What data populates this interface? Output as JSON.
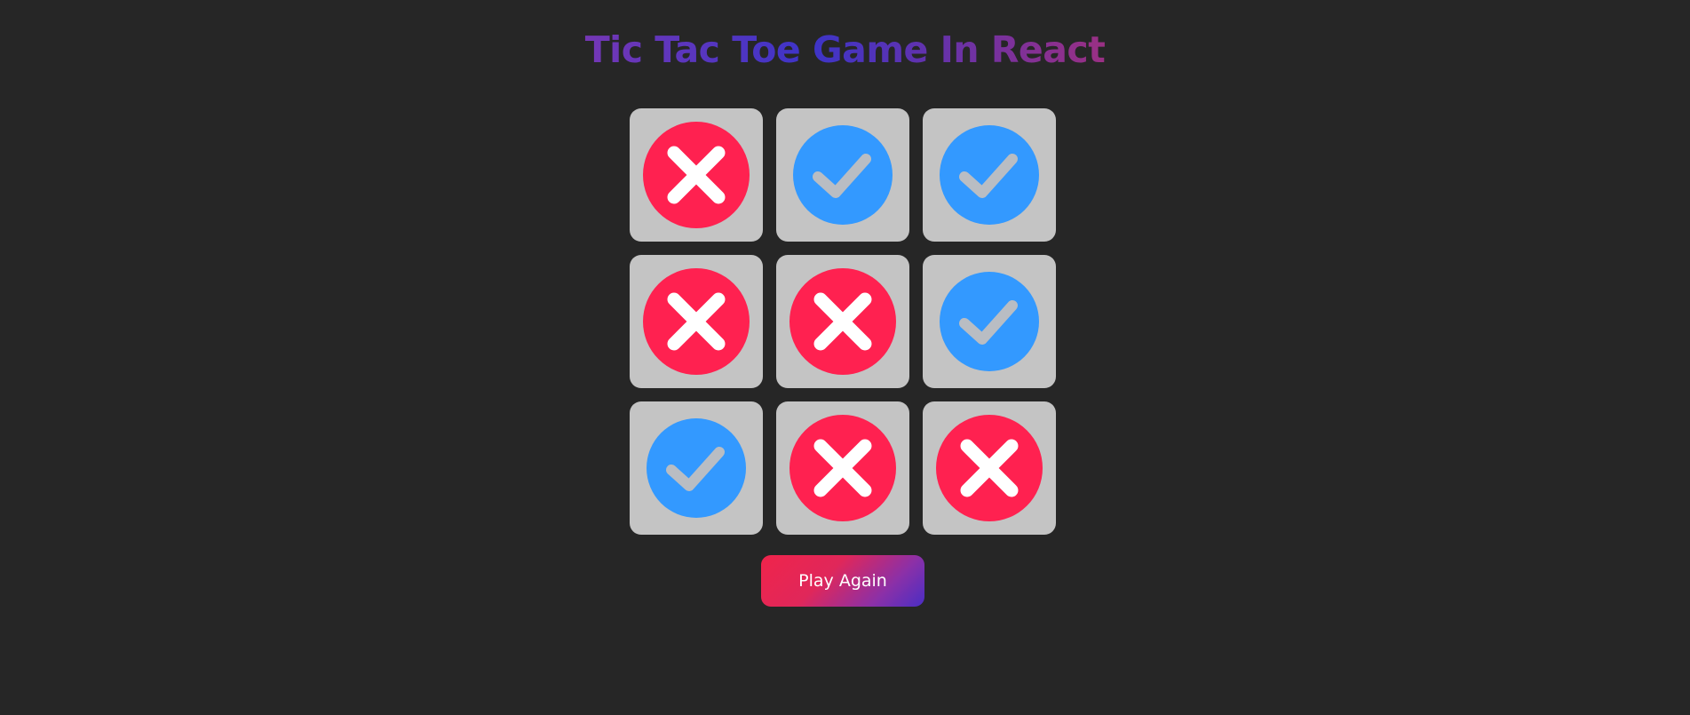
{
  "title": "Tic Tac Toe Game In React",
  "board": {
    "cells": [
      "x-icon",
      "check-icon",
      "check-icon",
      "x-icon",
      "x-icon",
      "check-icon",
      "check-icon",
      "x-icon",
      "x-icon"
    ]
  },
  "colors": {
    "background": "#262626",
    "cell": "#c4c4c4",
    "x_circle": "#ff2150",
    "check_circle": "#3399ff",
    "check_mark": "#b9bdc3"
  },
  "play_again_label": "Play Again"
}
